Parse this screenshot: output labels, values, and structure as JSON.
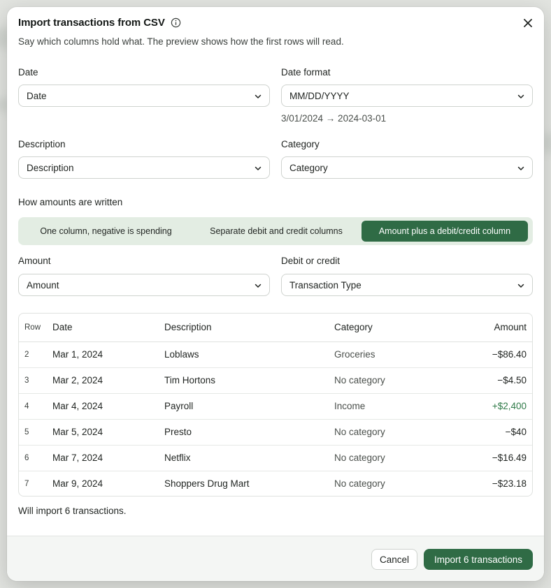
{
  "dialog": {
    "title": "Import transactions from CSV",
    "subtitle": "Say which columns hold what. The preview shows how the first rows will read."
  },
  "fields": {
    "date": {
      "label": "Date",
      "value": "Date"
    },
    "date_format": {
      "label": "Date format",
      "value": "MM/DD/YYYY",
      "example": "3/01/2024 → 2024-03-01"
    },
    "description": {
      "label": "Description",
      "value": "Description"
    },
    "category": {
      "label": "Category",
      "value": "Category"
    },
    "amount": {
      "label": "Amount",
      "value": "Amount"
    },
    "debit_credit": {
      "label": "Debit or credit",
      "value": "Transaction Type"
    }
  },
  "amount_mode": {
    "label": "How amounts are written",
    "options": [
      "One column, negative is spending",
      "Separate debit and credit columns",
      "Amount plus a debit/credit column"
    ],
    "selected": "Amount plus a debit/credit column"
  },
  "preview": {
    "headers": {
      "row": "Row",
      "date": "Date",
      "description": "Description",
      "category": "Category",
      "amount": "Amount"
    },
    "rows": [
      {
        "row": "2",
        "date": "Mar 1, 2024",
        "description": "Loblaws",
        "category": "Groceries",
        "amount": "−$86.40",
        "sign": "neg"
      },
      {
        "row": "3",
        "date": "Mar 2, 2024",
        "description": "Tim Hortons",
        "category": "No category",
        "amount": "−$4.50",
        "sign": "neg"
      },
      {
        "row": "4",
        "date": "Mar 4, 2024",
        "description": "Payroll",
        "category": "Income",
        "amount": "+$2,400",
        "sign": "pos"
      },
      {
        "row": "5",
        "date": "Mar 5, 2024",
        "description": "Presto",
        "category": "No category",
        "amount": "−$40",
        "sign": "neg"
      },
      {
        "row": "6",
        "date": "Mar 7, 2024",
        "description": "Netflix",
        "category": "No category",
        "amount": "−$16.49",
        "sign": "neg"
      },
      {
        "row": "7",
        "date": "Mar 9, 2024",
        "description": "Shoppers Drug Mart",
        "category": "No category",
        "amount": "−$23.18",
        "sign": "neg"
      }
    ]
  },
  "summary": "Will import 6 transactions.",
  "footer": {
    "cancel_label": "Cancel",
    "import_label": "Import 6 transactions"
  },
  "colors": {
    "accent": "#2f6b45",
    "positive": "#2f7a48",
    "segment_bg": "#e3ede3"
  },
  "icons": {
    "info": "info-icon",
    "close": "close-icon",
    "chevron": "chevron-down-icon"
  }
}
